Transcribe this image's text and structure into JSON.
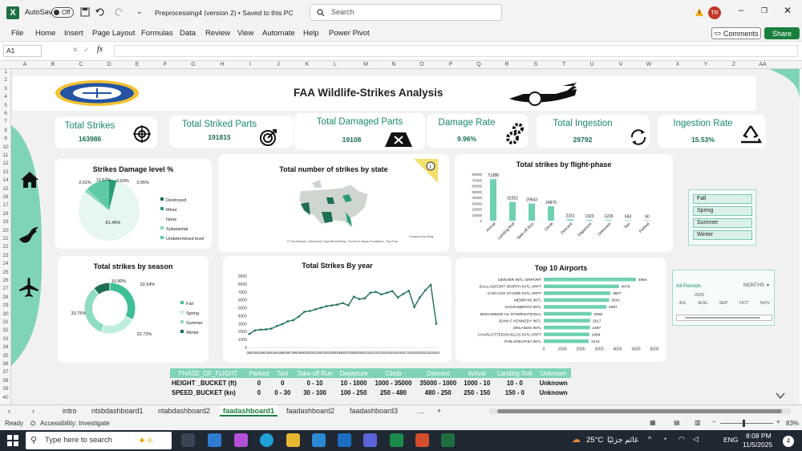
{
  "titlebar": {
    "autosave_label": "AutoSave",
    "autosave_state": "Off",
    "doc_title": "Preprocessing4 (version 2)  •  Saved to this PC",
    "search_placeholder": "Search",
    "avatar_initials": "TR"
  },
  "menu": [
    "File",
    "Home",
    "Insert",
    "Page Layout",
    "Formulas",
    "Data",
    "Review",
    "View",
    "Automate",
    "Help",
    "Power Pivot"
  ],
  "buttons": {
    "comments": "Comments",
    "share": "Share"
  },
  "formula": {
    "cell": "A1",
    "fx": "fx",
    "value": ""
  },
  "columns": [
    "A",
    "B",
    "C",
    "D",
    "E",
    "F",
    "G",
    "H",
    "I",
    "J",
    "K",
    "L",
    "M",
    "N",
    "O",
    "P",
    "Q",
    "R",
    "S",
    "T",
    "U",
    "V",
    "W",
    "X",
    "Y",
    "Z",
    "AA"
  ],
  "rows": [
    "1",
    "2",
    "3",
    "4",
    "5",
    "6",
    "7",
    "8",
    "9",
    "10",
    "11",
    "12",
    "13",
    "14",
    "15",
    "16",
    "17",
    "18",
    "19",
    "20",
    "21",
    "22",
    "23",
    "24",
    "25",
    "26",
    "27",
    "28",
    "29",
    "30",
    "31",
    "32",
    "33",
    "34",
    "35",
    "36",
    "37",
    "38",
    "39",
    "40"
  ],
  "dashboard": {
    "title": "FAA Wildlife-Strikes Analysis",
    "kpis": [
      {
        "label": "Total Strikes",
        "value": "163986",
        "icon": "target-icon"
      },
      {
        "label": "Total Striked Parts",
        "value": "191815",
        "icon": "dartboard-icon"
      },
      {
        "label": "Total Damaged Parts",
        "value": "19108",
        "icon": "damage-icon"
      },
      {
        "label": "Damage Rate",
        "value": "9.96%",
        "icon": "gears-icon"
      },
      {
        "label": "Total Ingestion",
        "value": "29792",
        "icon": "cycle-icon"
      },
      {
        "label": "Ingestion Rate",
        "value": "15.53%",
        "icon": "recycle-icon"
      }
    ],
    "map_title": "Total number of strikes by state",
    "map_footer": "© GeoNames, Microsoft, OpenStreetMap, Overture Maps Fundation, TomTom",
    "map_credit": "Powered by Bing",
    "slicer_seasons": [
      "Fall",
      "Spring",
      "Summer",
      "Winter"
    ],
    "timeline": {
      "label": "All Periods",
      "unit": "MONTHS",
      "year": "2025",
      "months": [
        "JUL",
        "AUG",
        "SEP",
        "OCT",
        "NOV"
      ]
    }
  },
  "colors": {
    "accent": "#5dc9a6",
    "dark_green": "#1c6e54",
    "teal_title": "#1d8a6c",
    "excel_green": "#1a7f3c"
  },
  "chart_data": [
    {
      "type": "pie",
      "title": "Strikes Damage level %",
      "categories": [
        "Destroyed",
        "Minor",
        "None",
        "Substantial",
        "Undetermined level"
      ],
      "values": [
        0.03,
        3.95,
        81.45,
        2.01,
        12.57
      ],
      "slice_labels": [
        "0.03%",
        "3.95%",
        "81.45%",
        "2.01%",
        "12.57%"
      ],
      "colors": [
        "#1c6e54",
        "#2a9b77",
        "#e6f6f0",
        "#8ad8bc",
        "#5dc9a6"
      ],
      "legend": "right"
    },
    {
      "type": "bar",
      "title": "Total strikes by flight-phase",
      "categories": [
        "Arrival",
        "Landing Roll",
        "Take-off Run",
        "Climb",
        "Descent",
        "Departure",
        "Unknown",
        "Taxi",
        "Parked"
      ],
      "values": [
        71388,
        32252,
        29543,
        24870,
        2331,
        1323,
        1226,
        593,
        60
      ],
      "yticks": [
        "80000",
        "70000",
        "60000",
        "50000",
        "40000",
        "30000",
        "20000",
        "10000",
        "0"
      ],
      "ylim": [
        0,
        80000
      ]
    },
    {
      "type": "pie",
      "title": "Total strikes by season",
      "categories": [
        "Fall",
        "Spring",
        "Summer",
        "Winter"
      ],
      "values": [
        32.64,
        22.72,
        33.75,
        10.9
      ],
      "slice_labels": [
        "32.64%",
        "22.72%",
        "33.75%",
        "10.90%"
      ],
      "colors": [
        "#3fbf98",
        "#bfeee0",
        "#8fdcc3",
        "#1c6e54"
      ],
      "legend": "right"
    },
    {
      "type": "line",
      "title": "Total Strikes By year",
      "x": [
        1990,
        1991,
        1992,
        1993,
        1994,
        1995,
        1996,
        1997,
        1998,
        1999,
        2000,
        2001,
        2002,
        2003,
        2004,
        2005,
        2006,
        2007,
        2008,
        2009,
        2010,
        2011,
        2012,
        2013,
        2014,
        2015,
        2016,
        2017,
        2018,
        2019,
        2020,
        2021,
        2022,
        2023,
        2024
      ],
      "values": [
        1700,
        2150,
        2250,
        2280,
        2380,
        2700,
        2950,
        3300,
        3450,
        3900,
        4500,
        4600,
        4800,
        5000,
        5200,
        5300,
        5400,
        5600,
        5300,
        6400,
        6100,
        6200,
        6900,
        7000,
        6700,
        6900,
        7100,
        6300,
        6750,
        7150,
        5100,
        6300,
        7200,
        7900,
        3000
      ],
      "x_labels": "199019911992199319941996199719981999200020012002200420052006200720082009201020122013201420152016201720182020202120222024",
      "yticks": [
        "9000",
        "8000",
        "7000",
        "6000",
        "5000",
        "4000",
        "3000",
        "2000",
        "1000",
        "0"
      ],
      "ylim": [
        0,
        9000
      ]
    },
    {
      "type": "bar",
      "orientation": "horizontal",
      "title": "Top 10 Airports",
      "categories": [
        "DENVER INTL AIRPORT",
        "DALLAS/FORT WORTH INTL ARPT",
        "CHICAGO O'HARE INTL ARPT",
        "MEMPHIS INTL",
        "SACRAMENTO INTL",
        "MUHAMMAD ALI INTERNATIONAL",
        "JOHN F KENNEDY INTL",
        "ORLANDO INTL",
        "CHARLOTTE/DOUGLAS INTL ARPT",
        "PHILADELPHIA INTL"
      ],
      "values": [
        4994,
        4076,
        3607,
        3541,
        3387,
        2592,
        2517,
        2497,
        2469,
        2441
      ],
      "xticks": [
        "0",
        "1000",
        "2000",
        "3000",
        "4000",
        "5000",
        "6000"
      ],
      "xlim": [
        0,
        6000
      ]
    }
  ],
  "phase_table": {
    "header": [
      "PHASE_OF_FLIGHT",
      "Parked",
      "Taxi",
      "Take-off Run",
      "Departure",
      "Climb",
      "Descent",
      "Arrival",
      "Landing Roll",
      "Unknown"
    ],
    "rows": [
      [
        "HEIGHT _BUCKET (ft)",
        "0",
        "0",
        "0 - 10",
        "10 - 1000",
        "1000 - 35000",
        "35000 - 1000",
        "1000 - 10",
        "10 - 0",
        "Unknown"
      ],
      [
        "SPEED_BUCKET (kn)",
        "0",
        "0 - 30",
        "30 - 100",
        "100 - 250",
        "250 - 480",
        "480 - 250",
        "250 - 150",
        "150 - 0",
        "Unknown"
      ]
    ]
  },
  "sheets": [
    "intro",
    "ntsbdashboard1",
    "ntabdashboard2",
    "faadashboard1",
    "faadashboard2",
    "faadashboard3"
  ],
  "active_sheet": "faadashboard1",
  "status": {
    "ready": "Ready",
    "accessibility": "Accessibility: Investigate",
    "zoom": "83%"
  },
  "taskbar": {
    "search": "Type here to search",
    "temp": "25°C",
    "weather": "غائم جزئيًا",
    "lang": "ENG",
    "time": "8:08 PM",
    "date": "11/5/2025",
    "notif": "4"
  }
}
